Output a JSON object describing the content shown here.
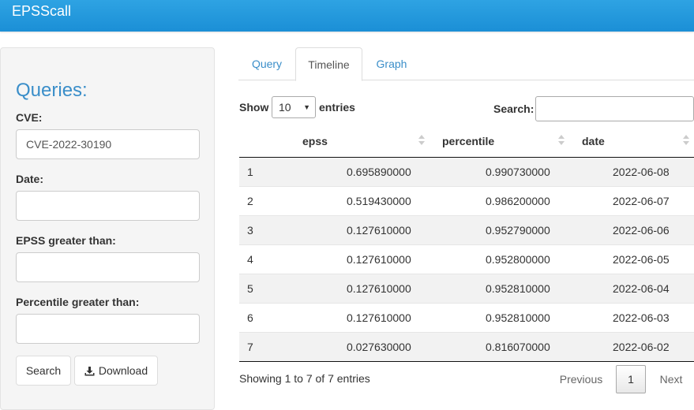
{
  "app": {
    "title": "EPSScall"
  },
  "sidebar": {
    "title": "Queries:",
    "cve_label": "CVE:",
    "cve_value": "CVE-2022-30190",
    "date_label": "Date:",
    "date_value": "",
    "epss_label": "EPSS greater than:",
    "epss_value": "",
    "percentile_label": "Percentile greater than:",
    "percentile_value": "",
    "search_button": "Search",
    "download_button": "Download"
  },
  "tabs": [
    {
      "label": "Query",
      "active": false
    },
    {
      "label": "Timeline",
      "active": true
    },
    {
      "label": "Graph",
      "active": false
    }
  ],
  "table_controls": {
    "show_label": "Show",
    "page_length": "10",
    "entries_label": "entries",
    "search_label": "Search:",
    "search_value": ""
  },
  "table": {
    "columns": [
      "",
      "epss",
      "percentile",
      "date"
    ],
    "rows": [
      [
        "1",
        "0.695890000",
        "0.990730000",
        "2022-06-08"
      ],
      [
        "2",
        "0.519430000",
        "0.986200000",
        "2022-06-07"
      ],
      [
        "3",
        "0.127610000",
        "0.952790000",
        "2022-06-06"
      ],
      [
        "4",
        "0.127610000",
        "0.952800000",
        "2022-06-05"
      ],
      [
        "5",
        "0.127610000",
        "0.952810000",
        "2022-06-04"
      ],
      [
        "6",
        "0.127610000",
        "0.952810000",
        "2022-06-03"
      ],
      [
        "7",
        "0.027630000",
        "0.816070000",
        "2022-06-02"
      ]
    ]
  },
  "pagination": {
    "info": "Showing 1 to 7 of 7 entries",
    "previous": "Previous",
    "current_page": "1",
    "next": "Next"
  },
  "colors": {
    "navbar": "#1b8fd6",
    "accent": "#3a8ec9"
  }
}
